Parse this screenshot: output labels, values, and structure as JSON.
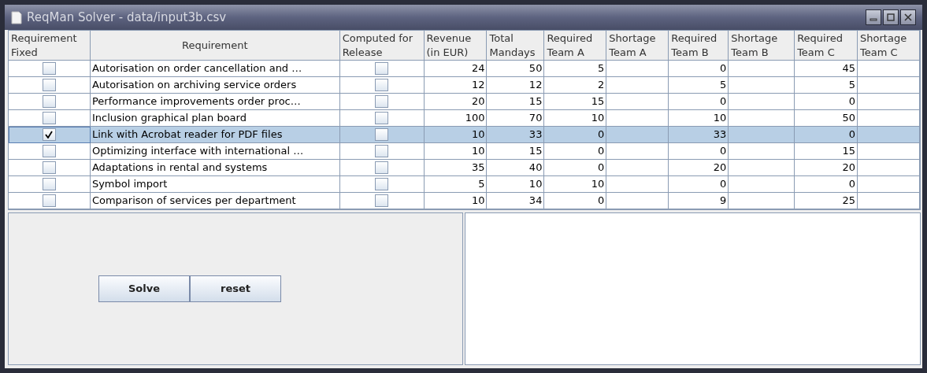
{
  "window": {
    "title": "ReqMan Solver - data/input3b.csv"
  },
  "table": {
    "columns": [
      [
        "Requirement",
        "Fixed"
      ],
      [
        "Requirement"
      ],
      [
        "Computed for",
        "Release"
      ],
      [
        "Revenue",
        "(in EUR)"
      ],
      [
        "Total",
        "Mandays"
      ],
      [
        "Required",
        "Team A"
      ],
      [
        "Shortage",
        "Team A"
      ],
      [
        "Required",
        "Team B"
      ],
      [
        "Shortage",
        "Team B"
      ],
      [
        "Required",
        "Team C"
      ],
      [
        "Shortage",
        "Team C"
      ]
    ],
    "rows": [
      {
        "fixed": false,
        "name": "Autorisation on order cancellation and …",
        "computed": false,
        "selected": false,
        "revenue": "24",
        "mandays": "50",
        "team_a": "5",
        "team_b": "0",
        "team_c": "45"
      },
      {
        "fixed": false,
        "name": "Autorisation on archiving service orders",
        "computed": false,
        "selected": false,
        "revenue": "12",
        "mandays": "12",
        "team_a": "2",
        "team_b": "5",
        "team_c": "5"
      },
      {
        "fixed": false,
        "name": "Performance improvements order proc…",
        "computed": false,
        "selected": false,
        "revenue": "20",
        "mandays": "15",
        "team_a": "15",
        "team_b": "0",
        "team_c": "0"
      },
      {
        "fixed": false,
        "name": "Inclusion graphical plan board",
        "computed": false,
        "selected": false,
        "revenue": "100",
        "mandays": "70",
        "team_a": "10",
        "team_b": "10",
        "team_c": "50"
      },
      {
        "fixed": true,
        "name": "Link with Acrobat reader for PDF files",
        "computed": false,
        "selected": true,
        "revenue": "10",
        "mandays": "33",
        "team_a": "0",
        "team_b": "33",
        "team_c": "0"
      },
      {
        "fixed": false,
        "name": "Optimizing interface with international …",
        "computed": false,
        "selected": false,
        "revenue": "10",
        "mandays": "15",
        "team_a": "0",
        "team_b": "0",
        "team_c": "15"
      },
      {
        "fixed": false,
        "name": "Adaptations in rental and systems",
        "computed": false,
        "selected": false,
        "revenue": "35",
        "mandays": "40",
        "team_a": "0",
        "team_b": "20",
        "team_c": "20"
      },
      {
        "fixed": false,
        "name": "Symbol import",
        "computed": false,
        "selected": false,
        "revenue": "5",
        "mandays": "10",
        "team_a": "10",
        "team_b": "0",
        "team_c": "0"
      },
      {
        "fixed": false,
        "name": "Comparison of services per department",
        "computed": false,
        "selected": false,
        "revenue": "10",
        "mandays": "34",
        "team_a": "0",
        "team_b": "9",
        "team_c": "25"
      }
    ]
  },
  "buttons": [
    "Solve",
    "reset"
  ]
}
